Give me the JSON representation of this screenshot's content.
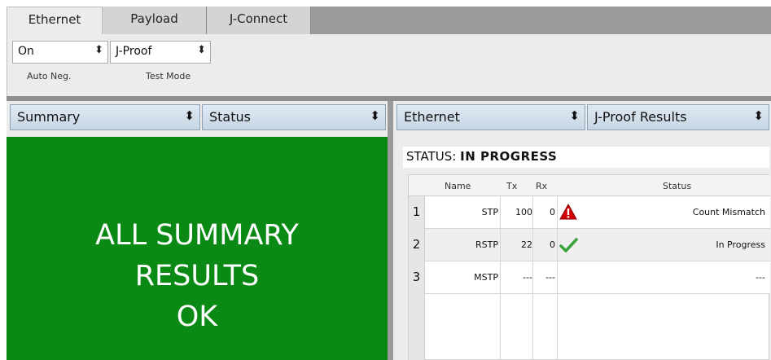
{
  "tabs": [
    "Ethernet",
    "Payload",
    "J-Connect"
  ],
  "controls": {
    "auto_neg": {
      "value": "On",
      "label": "Auto Neg."
    },
    "test_mode": {
      "value": "J-Proof",
      "label": "Test Mode"
    }
  },
  "left_panel": {
    "summary_dropdown": "Summary",
    "status_dropdown": "Status",
    "message_lines": [
      "ALL SUMMARY",
      "RESULTS",
      "OK"
    ],
    "message_bg": "#0a8a15"
  },
  "right_panel": {
    "category_dropdown": "Ethernet",
    "results_dropdown": "J-Proof Results",
    "status_label": "STATUS:",
    "status_value": "IN PROGRESS",
    "table": {
      "columns": [
        "Name",
        "Tx",
        "Rx",
        "Status"
      ],
      "rows": [
        {
          "num": "1",
          "name": "STP",
          "tx": "100",
          "rx": "0",
          "icon": "warning-icon",
          "status": "Count Mismatch"
        },
        {
          "num": "2",
          "name": "RSTP",
          "tx": "22",
          "rx": "0",
          "icon": "check-icon",
          "status": "In Progress"
        },
        {
          "num": "3",
          "name": "MSTP",
          "tx": "---",
          "rx": "---",
          "icon": "",
          "status": "---"
        }
      ]
    }
  },
  "colors": {
    "ok_green": "#0a8a15",
    "warning_red": "#d40000",
    "check_green": "#3aa23a"
  }
}
